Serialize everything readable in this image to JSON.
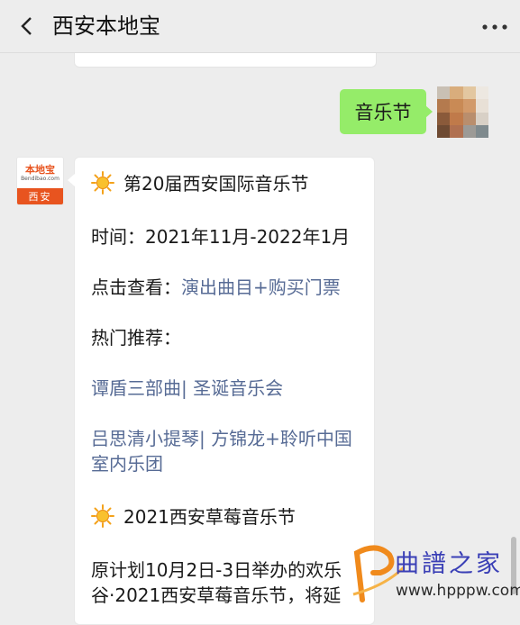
{
  "header": {
    "title": "西安本地宝",
    "back_icon": "chevron-left-icon",
    "more_icon": "more-dots-icon"
  },
  "my_message": {
    "text": "音乐节",
    "bubble_color": "#95ec69"
  },
  "bot": {
    "avatar": {
      "logo_text": "本地宝",
      "logo_sub": "Bendibao.com",
      "city": "西安",
      "brand_color": "#e8541f"
    }
  },
  "message": {
    "section1_title": "第20届西安国际音乐节",
    "time_line": "时间：2021年11月-2022年1月",
    "view_label": "点击查看：",
    "view_link": "演出曲目+购买门票",
    "hot_label": "热门推荐：",
    "rec1_link_a": "谭盾三部曲",
    "rec1_sep": "| ",
    "rec1_link_b": "圣诞音乐会",
    "rec2_link_a": "吕思清小提琴",
    "rec2_sep": "| ",
    "rec2_link_b_line1": "方锦龙+聆听中国",
    "rec2_link_b_line2": "室内乐团",
    "section2_title": "2021西安草莓音乐节",
    "body_line1": "原计划10月2日-3日举办的欢乐",
    "body_line2": "谷·2021西安草莓音乐节，将延",
    "link_color": "#576b95"
  },
  "watermark": {
    "text": "曲譜之家",
    "url": "www.hpppw.com"
  }
}
